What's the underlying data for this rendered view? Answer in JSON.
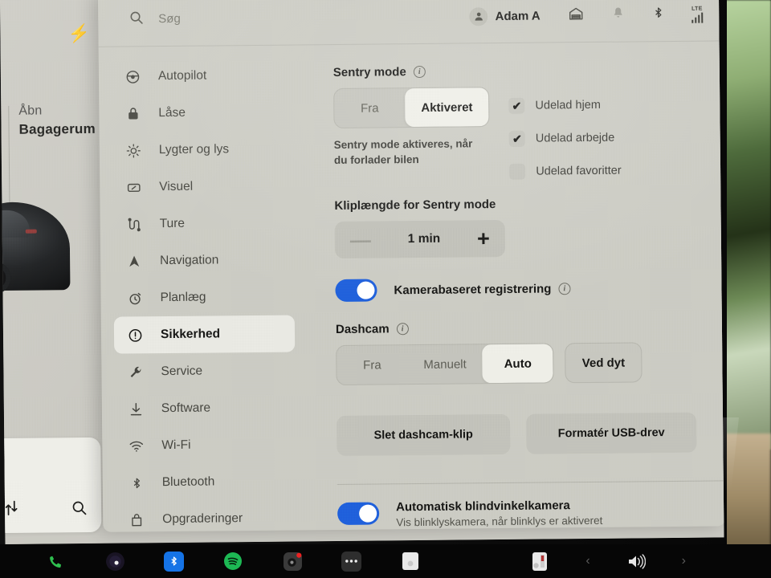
{
  "home": {
    "trunk_line1": "Åbn",
    "trunk_line2": "Bagagerum",
    "charge_icon": "charging-bolt-icon",
    "corner_sliders_icon": "sliders-icon",
    "corner_search_icon": "search-icon"
  },
  "topbar": {
    "search_icon": "search-icon",
    "search_placeholder": "Søg",
    "user_name": "Adam A",
    "avatar_icon": "person-icon",
    "garage_icon": "garage-icon",
    "bell_icon": "bell-icon",
    "bluetooth_icon": "bluetooth-icon",
    "lte_label": "LTE",
    "signal_icon": "signal-bars-icon"
  },
  "sidebar": {
    "items": [
      {
        "label": "Autopilot",
        "icon": "steering-wheel-icon",
        "active": false
      },
      {
        "label": "Låse",
        "icon": "lock-icon",
        "active": false
      },
      {
        "label": "Lygter og lys",
        "icon": "sun-brightness-icon",
        "active": false
      },
      {
        "label": "Visuel",
        "icon": "display-icon",
        "active": false
      },
      {
        "label": "Ture",
        "icon": "route-icon",
        "active": false
      },
      {
        "label": "Navigation",
        "icon": "navigation-arrow-icon",
        "active": false
      },
      {
        "label": "Planlæg",
        "icon": "alarm-clock-icon",
        "active": false
      },
      {
        "label": "Sikkerhed",
        "icon": "alert-circle-icon",
        "active": true
      },
      {
        "label": "Service",
        "icon": "wrench-icon",
        "active": false
      },
      {
        "label": "Software",
        "icon": "download-icon",
        "active": false
      },
      {
        "label": "Wi-Fi",
        "icon": "wifi-icon",
        "active": false
      },
      {
        "label": "Bluetooth",
        "icon": "bluetooth-icon",
        "active": false
      },
      {
        "label": "Opgraderinger",
        "icon": "bag-upgrade-icon",
        "active": false
      }
    ]
  },
  "content": {
    "sentry": {
      "title": "Sentry mode",
      "info_icon": "info-icon",
      "options": [
        "Fra",
        "Aktiveret"
      ],
      "selected": "Aktiveret",
      "helper": "Sentry mode aktiveres, når du forlader bilen",
      "checkboxes": [
        {
          "label": "Udelad hjem",
          "checked": true,
          "mark": "✔"
        },
        {
          "label": "Udelad arbejde",
          "checked": true,
          "mark": "✔"
        },
        {
          "label": "Udelad favoritter",
          "checked": false,
          "mark": ""
        }
      ]
    },
    "clip_length": {
      "title": "Kliplængde for Sentry mode",
      "minus": "—",
      "value": "1 min",
      "plus": "+"
    },
    "camera_detection": {
      "label": "Kamerabaseret registrering",
      "info_icon": "info-icon",
      "enabled": true
    },
    "dashcam": {
      "title": "Dashcam",
      "info_icon": "info-icon",
      "options": [
        "Fra",
        "Manuelt",
        "Auto"
      ],
      "selected": "Auto",
      "extra_button": "Ved dyt",
      "actions": [
        "Slet dashcam-klip",
        "Formatér USB-drev"
      ]
    },
    "blindspot": {
      "label": "Automatisk blindvinkelkamera",
      "sub": "Vis blinklyskamera, når blinklys er aktiveret",
      "enabled": true
    }
  },
  "taskbar": {
    "icons": [
      "phone-icon",
      "camera-lens-icon",
      "bluetooth-app-icon",
      "spotify-icon",
      "dashcam-record-icon",
      "more-dots-icon",
      "app-icon"
    ],
    "climate_icon": "thermometer-icon",
    "prev_label": "‹",
    "volume_icon": "volume-icon",
    "next_label": "›"
  },
  "colors": {
    "accent_blue": "#1f5fdb",
    "panel_bg": "#cbcbc3",
    "selected_bg": "#eeeee7",
    "spotify_green": "#1db954",
    "bluetooth_blue": "#1573e6"
  }
}
